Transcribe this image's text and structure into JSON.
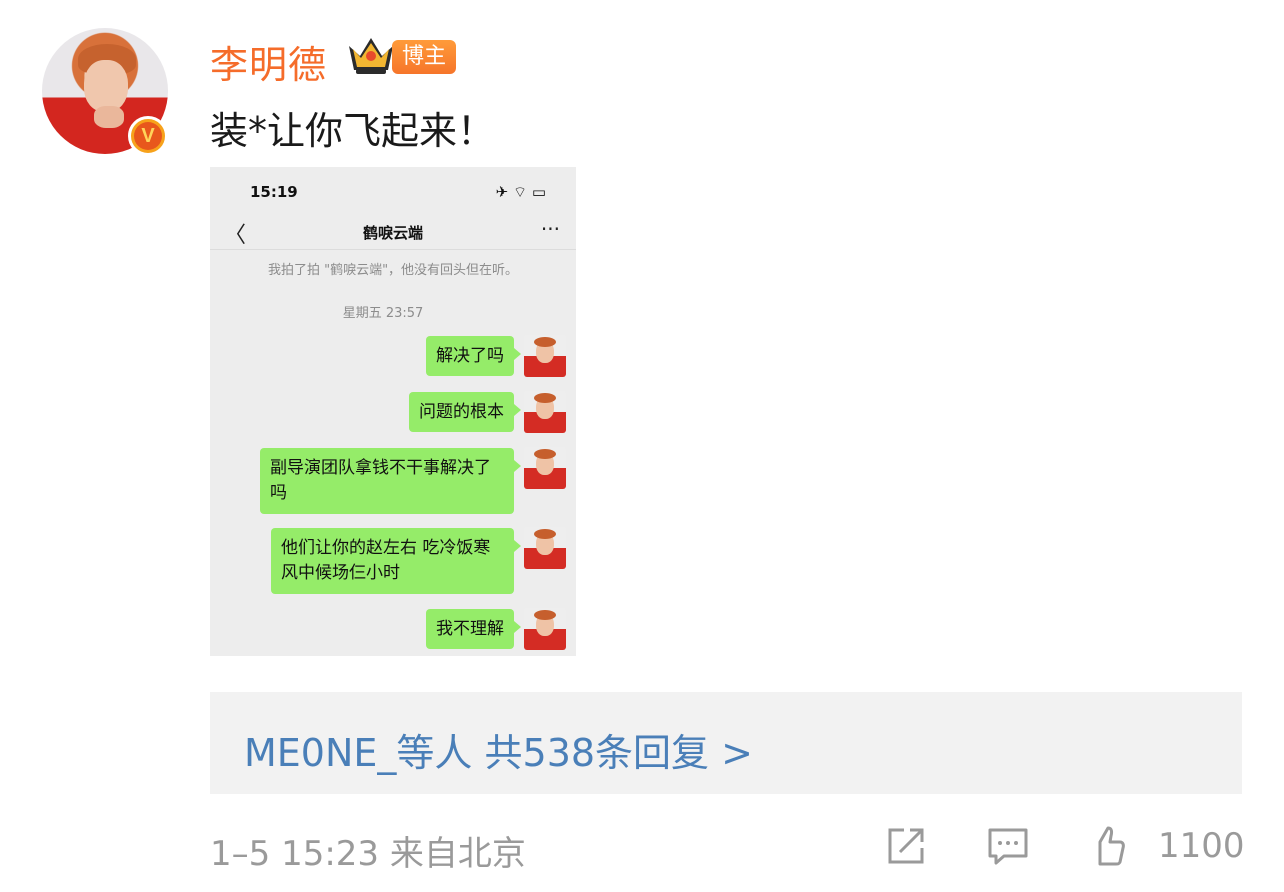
{
  "post": {
    "username": "李明德",
    "host_tag": "博主",
    "verified_badge": "V",
    "text": "装*让你飞起来！",
    "meta": "1–5 15:23  来自北京",
    "like_count": "1100"
  },
  "screenshot": {
    "status_time": "15:19",
    "status_icons": "✈ ⌔ ▭",
    "back": "〈",
    "chat_title": "鹤唳云端",
    "more": "···",
    "pat_text": "我拍了拍 \"鹤唳云端\"，他没有回头但在听。",
    "time_label": "星期五 23:57",
    "messages": [
      "解决了吗",
      "问题的根本",
      "副导演团队拿钱不干事解决了吗",
      "他们让你的赵左右 吃冷饭寒风中候场仨小时",
      "我不理解"
    ]
  },
  "replies": {
    "users": "ME0NE_等人",
    "count_text": "共538条回复 >"
  },
  "colors": {
    "username": "#f56c2a",
    "link": "#4a7fb8",
    "bubble": "#95ec69",
    "meta": "#9a9a9a"
  },
  "icons": [
    "crown-icon",
    "share-icon",
    "comment-icon",
    "like-icon"
  ]
}
